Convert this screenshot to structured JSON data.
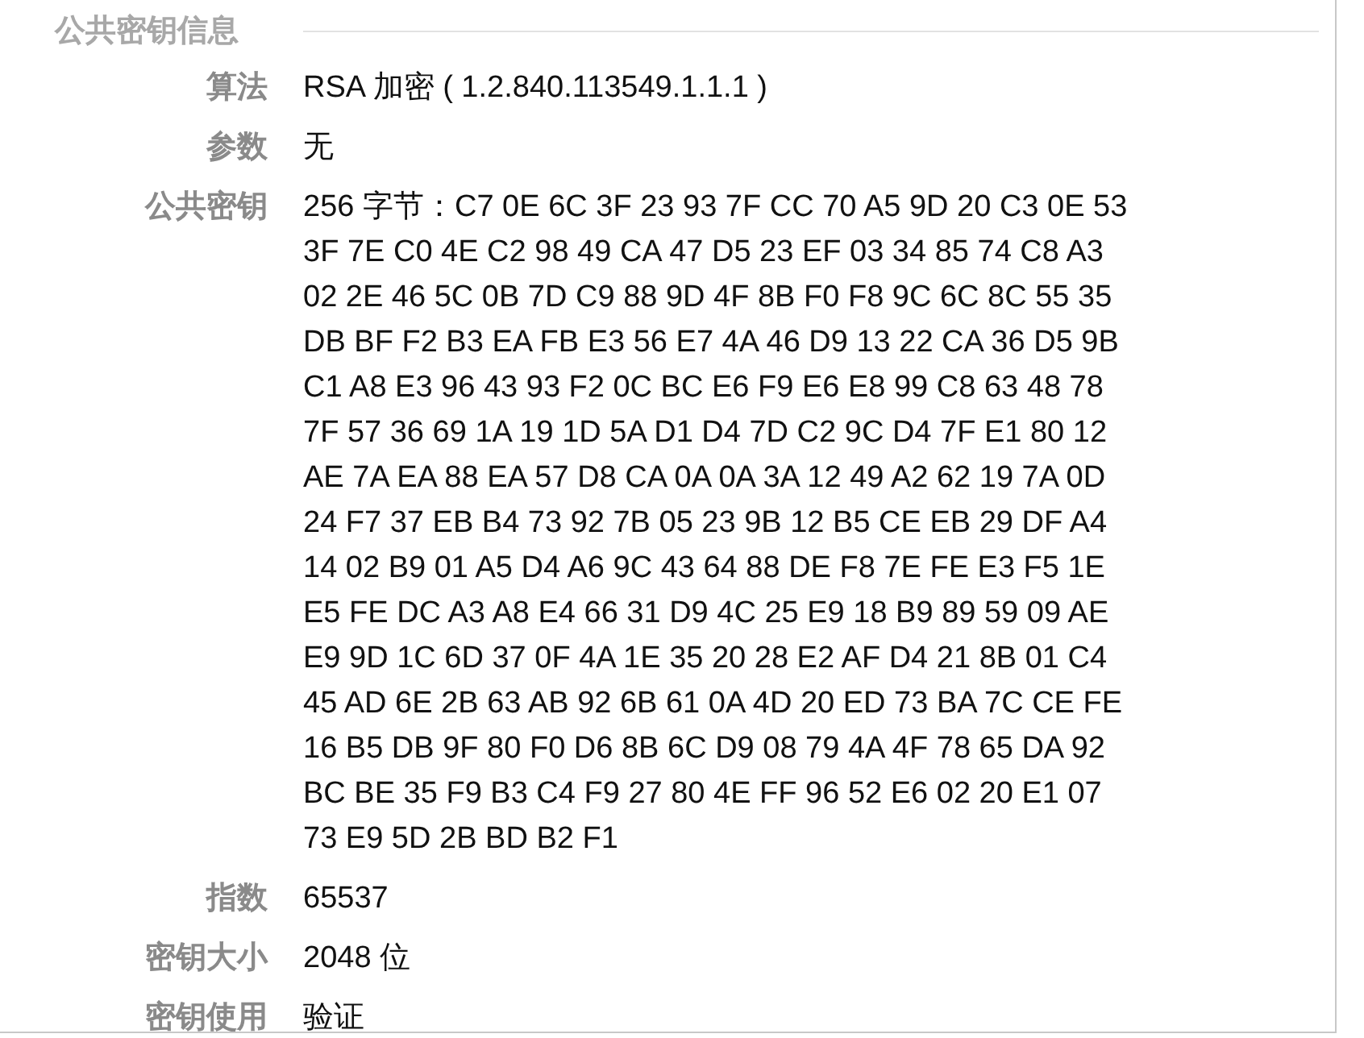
{
  "section": {
    "title": "公共密钥信息"
  },
  "fields": [
    {
      "label": "算法",
      "lines": [
        "RSA 加密 ( 1.2.840.113549.1.1.1 )"
      ]
    },
    {
      "label": "参数",
      "lines": [
        "无"
      ]
    },
    {
      "label": "公共密钥",
      "lines": [
        "256 字节：C7 0E 6C 3F 23 93 7F CC 70 A5 9D 20 C3 0E 53",
        "3F 7E C0 4E C2 98 49 CA 47 D5 23 EF 03 34 85 74 C8 A3",
        "02 2E 46 5C 0B 7D C9 88 9D 4F 8B F0 F8 9C 6C 8C 55 35",
        "DB BF F2 B3 EA FB E3 56 E7 4A 46 D9 13 22 CA 36 D5 9B",
        "C1 A8 E3 96 43 93 F2 0C BC E6 F9 E6 E8 99 C8 63 48 78",
        "7F 57 36 69 1A 19 1D 5A D1 D4 7D C2 9C D4 7F E1 80 12",
        "AE 7A EA 88 EA 57 D8 CA 0A 0A 3A 12 49 A2 62 19 7A 0D",
        "24 F7 37 EB B4 73 92 7B 05 23 9B 12 B5 CE EB 29 DF A4",
        "14 02 B9 01 A5 D4 A6 9C 43 64 88 DE F8 7E FE E3 F5 1E",
        "E5 FE DC A3 A8 E4 66 31 D9 4C 25 E9 18 B9 89 59 09 AE",
        "E9 9D 1C 6D 37 0F 4A 1E 35 20 28 E2 AF D4 21 8B 01 C4",
        "45 AD 6E 2B 63 AB 92 6B 61 0A 4D 20 ED 73 BA 7C CE FE",
        "16 B5 DB 9F 80 F0 D6 8B 6C D9 08 79 4A 4F 78 65 DA 92",
        "BC BE 35 F9 B3 C4 F9 27 80 4E FF 96 52 E6 02 20 E1 07",
        "73 E9 5D 2B BD B2 F1"
      ]
    },
    {
      "label": "指数",
      "lines": [
        "65537"
      ]
    },
    {
      "label": "密钥大小",
      "lines": [
        "2048 位"
      ]
    },
    {
      "label": "密钥使用",
      "lines": [
        "验证"
      ]
    }
  ]
}
